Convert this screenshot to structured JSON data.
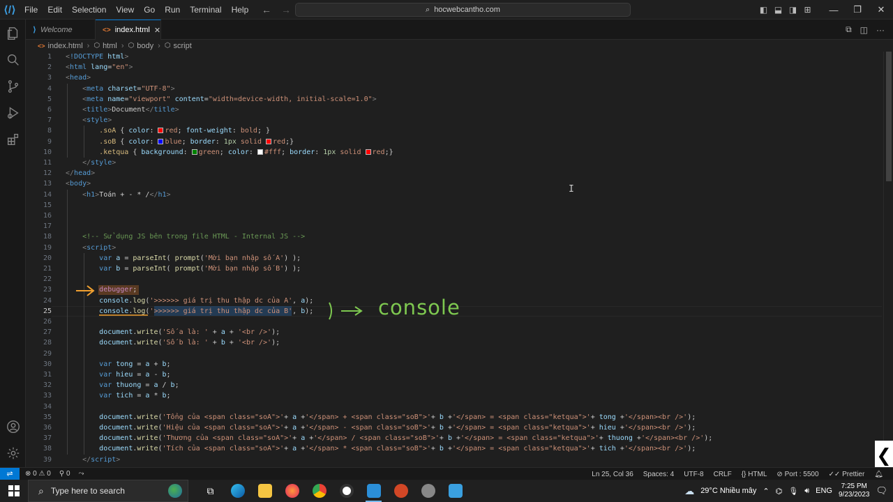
{
  "menu": [
    "File",
    "Edit",
    "Selection",
    "View",
    "Go",
    "Run",
    "Terminal",
    "Help"
  ],
  "search": {
    "text": "hocwebcantho.com"
  },
  "tabs": [
    {
      "label": "Welcome"
    },
    {
      "label": "index.html"
    }
  ],
  "breadcrumb": [
    "index.html",
    "html",
    "body",
    "script"
  ],
  "editor": {
    "current_line": 25,
    "lines": [
      {
        "n": 1,
        "h": "<span style=\"color:#808080\">&lt;</span><span style=\"color:#569cd6\">!DOCTYPE</span> <span style=\"color:#9cdcfe\">html</span><span style=\"color:#808080\">&gt;</span>"
      },
      {
        "n": 2,
        "h": "<span style=\"color:#808080\">&lt;</span><span style=\"color:#569cd6\">html</span> <span style=\"color:#9cdcfe\">lang</span>=<span style=\"color:#ce9178\">\"en\"</span><span style=\"color:#808080\">&gt;</span>"
      },
      {
        "n": 3,
        "h": "<span style=\"color:#808080\">&lt;</span><span style=\"color:#569cd6\">head</span><span style=\"color:#808080\">&gt;</span>"
      },
      {
        "n": 4,
        "h": "    <span style=\"color:#808080\">&lt;</span><span style=\"color:#569cd6\">meta</span> <span style=\"color:#9cdcfe\">charset</span>=<span style=\"color:#ce9178\">\"UTF-8\"</span><span style=\"color:#808080\">&gt;</span>"
      },
      {
        "n": 5,
        "h": "    <span style=\"color:#808080\">&lt;</span><span style=\"color:#569cd6\">meta</span> <span style=\"color:#9cdcfe\">name</span>=<span style=\"color:#ce9178\">\"viewport\"</span> <span style=\"color:#9cdcfe\">content</span>=<span style=\"color:#ce9178\">\"width=device-width, initial-scale=1.0\"</span><span style=\"color:#808080\">&gt;</span>"
      },
      {
        "n": 6,
        "h": "    <span style=\"color:#808080\">&lt;</span><span style=\"color:#569cd6\">title</span><span style=\"color:#808080\">&gt;</span>Document<span style=\"color:#808080\">&lt;/</span><span style=\"color:#569cd6\">title</span><span style=\"color:#808080\">&gt;</span>"
      },
      {
        "n": 7,
        "h": "    <span style=\"color:#808080\">&lt;</span><span style=\"color:#569cd6\">style</span><span style=\"color:#808080\">&gt;</span>"
      },
      {
        "n": 8,
        "h": "        <span style=\"color:#d7ba7d\">.soA</span> { <span style=\"color:#9cdcfe\">color</span>: <span class=\"sw\" style=\"background:#ff0000\"></span><span style=\"color:#ce9178\">red</span>; <span style=\"color:#9cdcfe\">font-weight</span>: <span style=\"color:#ce9178\">bold</span>; }"
      },
      {
        "n": 9,
        "h": "        <span style=\"color:#d7ba7d\">.soB</span> { <span style=\"color:#9cdcfe\">color</span>: <span class=\"sw\" style=\"background:#0000ff\"></span><span style=\"color:#ce9178\">blue</span>; <span style=\"color:#9cdcfe\">border</span>: <span style=\"color:#b5cea8\">1px</span> <span style=\"color:#ce9178\">solid</span> <span class=\"sw\" style=\"background:#ff0000\"></span><span style=\"color:#ce9178\">red</span>;}"
      },
      {
        "n": 10,
        "h": "        <span style=\"color:#d7ba7d\">.ketqua</span> { <span style=\"color:#9cdcfe\">background</span>: <span class=\"sw\" style=\"background:#008000\"></span><span style=\"color:#ce9178\">green</span>; <span style=\"color:#9cdcfe\">color</span>: <span class=\"sw\" style=\"background:#ffffff\"></span><span style=\"color:#ce9178\">#fff</span>; <span style=\"color:#9cdcfe\">border</span>: <span style=\"color:#b5cea8\">1px</span> <span style=\"color:#ce9178\">solid</span> <span class=\"sw\" style=\"background:#ff0000\"></span><span style=\"color:#ce9178\">red</span>;}"
      },
      {
        "n": 11,
        "h": "    <span style=\"color:#808080\">&lt;/</span><span style=\"color:#569cd6\">style</span><span style=\"color:#808080\">&gt;</span>"
      },
      {
        "n": 12,
        "h": "<span style=\"color:#808080\">&lt;/</span><span style=\"color:#569cd6\">head</span><span style=\"color:#808080\">&gt;</span>"
      },
      {
        "n": 13,
        "h": "<span style=\"color:#808080\">&lt;</span><span style=\"color:#569cd6\">body</span><span style=\"color:#808080\">&gt;</span>"
      },
      {
        "n": 14,
        "h": "    <span style=\"color:#808080\">&lt;</span><span style=\"color:#569cd6\">h1</span><span style=\"color:#808080\">&gt;</span>Toán + - * /<span style=\"color:#808080\">&lt;/</span><span style=\"color:#569cd6\">h1</span><span style=\"color:#808080\">&gt;</span>"
      },
      {
        "n": 15,
        "h": ""
      },
      {
        "n": 16,
        "h": ""
      },
      {
        "n": 17,
        "h": ""
      },
      {
        "n": 18,
        "h": "    <span style=\"color:#6a9955\">&lt;!-- Sử dụng JS bên trong file HTML - Internal JS --&gt;</span>"
      },
      {
        "n": 19,
        "h": "    <span style=\"color:#808080\">&lt;</span><span style=\"color:#569cd6\">script</span><span style=\"color:#808080\">&gt;</span>"
      },
      {
        "n": 20,
        "h": "        <span style=\"color:#569cd6\">var</span> <span style=\"color:#9cdcfe\">a</span> = <span style=\"color:#dcdcaa\">parseInt</span>( <span style=\"color:#dcdcaa\">prompt</span>(<span style=\"color:#ce9178\">'Mời bạn nhập số A'</span>) );"
      },
      {
        "n": 21,
        "h": "        <span style=\"color:#569cd6\">var</span> <span style=\"color:#9cdcfe\">b</span> = <span style=\"color:#dcdcaa\">parseInt</span>( <span style=\"color:#dcdcaa\">prompt</span>(<span style=\"color:#ce9178\">'Mời bạn nhập số B'</span>) );"
      },
      {
        "n": 22,
        "h": ""
      },
      {
        "n": 23,
        "h": "        <span style=\"color:#c586c0\">debugger</span>;"
      },
      {
        "n": 24,
        "h": "        <span style=\"color:#9cdcfe\">console</span>.<span style=\"color:#dcdcaa\">log</span>(<span style=\"color:#ce9178\">'&gt;&gt;&gt;&gt;&gt;&gt; giá trị thu thập dc của A'</span>, <span style=\"color:#9cdcfe\">a</span>);"
      },
      {
        "n": 25,
        "h": "        <span style=\"color:#9cdcfe\">console</span>.<span style=\"color:#dcdcaa\">log</span>(<span style=\"color:#ce9178\">'&gt;&gt;&gt;&gt;&gt;&gt; giá trị thu thập dc của B'</span>, <span style=\"color:#9cdcfe\">b</span>);"
      },
      {
        "n": 26,
        "h": ""
      },
      {
        "n": 27,
        "h": "        <span style=\"color:#9cdcfe\">document</span>.<span style=\"color:#dcdcaa\">write</span>(<span style=\"color:#ce9178\">'Số a là: '</span> + <span style=\"color:#9cdcfe\">a</span> + <span style=\"color:#ce9178\">'&lt;br /&gt;'</span>);"
      },
      {
        "n": 28,
        "h": "        <span style=\"color:#9cdcfe\">document</span>.<span style=\"color:#dcdcaa\">write</span>(<span style=\"color:#ce9178\">'Số b là: '</span> + <span style=\"color:#9cdcfe\">b</span> + <span style=\"color:#ce9178\">'&lt;br /&gt;'</span>);"
      },
      {
        "n": 29,
        "h": ""
      },
      {
        "n": 30,
        "h": "        <span style=\"color:#569cd6\">var</span> <span style=\"color:#9cdcfe\">tong</span> = <span style=\"color:#9cdcfe\">a</span> + <span style=\"color:#9cdcfe\">b</span>;"
      },
      {
        "n": 31,
        "h": "        <span style=\"color:#569cd6\">var</span> <span style=\"color:#9cdcfe\">hieu</span> = <span style=\"color:#9cdcfe\">a</span> - <span style=\"color:#9cdcfe\">b</span>;"
      },
      {
        "n": 32,
        "h": "        <span style=\"color:#569cd6\">var</span> <span style=\"color:#9cdcfe\">thuong</span> = <span style=\"color:#9cdcfe\">a</span> / <span style=\"color:#9cdcfe\">b</span>;"
      },
      {
        "n": 33,
        "h": "        <span style=\"color:#569cd6\">var</span> <span style=\"color:#9cdcfe\">tich</span> = <span style=\"color:#9cdcfe\">a</span> * <span style=\"color:#9cdcfe\">b</span>;"
      },
      {
        "n": 34,
        "h": ""
      },
      {
        "n": 35,
        "h": "        <span style=\"color:#9cdcfe\">document</span>.<span style=\"color:#dcdcaa\">write</span>(<span style=\"color:#ce9178\">'Tổng của &lt;span class=\"soA\"&gt;'</span>+ <span style=\"color:#9cdcfe\">a</span> +<span style=\"color:#ce9178\">'&lt;/span&gt; + &lt;span class=\"soB\"&gt;'</span>+ <span style=\"color:#9cdcfe\">b</span> +<span style=\"color:#ce9178\">'&lt;/span&gt; = &lt;span class=\"ketqua\"&gt;'</span>+ <span style=\"color:#9cdcfe\">tong</span> +<span style=\"color:#ce9178\">'&lt;/span&gt;&lt;br /&gt;'</span>);"
      },
      {
        "n": 36,
        "h": "        <span style=\"color:#9cdcfe\">document</span>.<span style=\"color:#dcdcaa\">write</span>(<span style=\"color:#ce9178\">'Hiệu của &lt;span class=\"soA\"&gt;'</span>+ <span style=\"color:#9cdcfe\">a</span> +<span style=\"color:#ce9178\">'&lt;/span&gt; - &lt;span class=\"soB\"&gt;'</span>+ <span style=\"color:#9cdcfe\">b</span> +<span style=\"color:#ce9178\">'&lt;/span&gt; = &lt;span class=\"ketqua\"&gt;'</span>+ <span style=\"color:#9cdcfe\">hieu</span> +<span style=\"color:#ce9178\">'&lt;/span&gt;&lt;br /&gt;'</span>);"
      },
      {
        "n": 37,
        "h": "        <span style=\"color:#9cdcfe\">document</span>.<span style=\"color:#dcdcaa\">write</span>(<span style=\"color:#ce9178\">'Thương của &lt;span class=\"soA\"&gt;'</span>+ <span style=\"color:#9cdcfe\">a</span> +<span style=\"color:#ce9178\">'&lt;/span&gt; / &lt;span class=\"soB\"&gt;'</span>+ <span style=\"color:#9cdcfe\">b</span> +<span style=\"color:#ce9178\">'&lt;/span&gt; = &lt;span class=\"ketqua\"&gt;'</span>+ <span style=\"color:#9cdcfe\">thuong</span> +<span style=\"color:#ce9178\">'&lt;/span&gt;&lt;br /&gt;'</span>);"
      },
      {
        "n": 38,
        "h": "        <span style=\"color:#9cdcfe\">document</span>.<span style=\"color:#dcdcaa\">write</span>(<span style=\"color:#ce9178\">'Tích của &lt;span class=\"soA\"&gt;'</span>+ <span style=\"color:#9cdcfe\">a</span> +<span style=\"color:#ce9178\">'&lt;/span&gt; * &lt;span class=\"soB\"&gt;'</span>+ <span style=\"color:#9cdcfe\">b</span> +<span style=\"color:#ce9178\">'&lt;/span&gt; = &lt;span class=\"ketqua\"&gt;'</span>+ <span style=\"color:#9cdcfe\">tich</span> +<span style=\"color:#ce9178\">'&lt;/span&gt;&lt;br /&gt;'</span>);"
      },
      {
        "n": 39,
        "h": "    <span style=\"color:#808080\">&lt;/</span><span style=\"color:#569cd6\">script</span><span style=\"color:#808080\">&gt;</span>"
      }
    ]
  },
  "annotation": {
    "text": ") —> console",
    "color": "#7ec850",
    "arrow_color": "#f0a030"
  },
  "statusbar": {
    "errors": "0",
    "warnings": "0",
    "ports": "0",
    "position": "Ln 25, Col 36",
    "spaces": "Spaces: 4",
    "encoding": "UTF-8",
    "eol": "CRLF",
    "language": "HTML",
    "port": "Port : 5500",
    "formatter": "Prettier"
  },
  "taskbar": {
    "search_placeholder": "Type here to search",
    "weather": "29°C  Nhiều mây",
    "lang": "ENG",
    "time": "7:25 PM",
    "date": "9/23/2023"
  },
  "colors": {
    "accent": "#0078d4",
    "status_bg": "#181818",
    "editor_bg": "#1f1f1f"
  }
}
